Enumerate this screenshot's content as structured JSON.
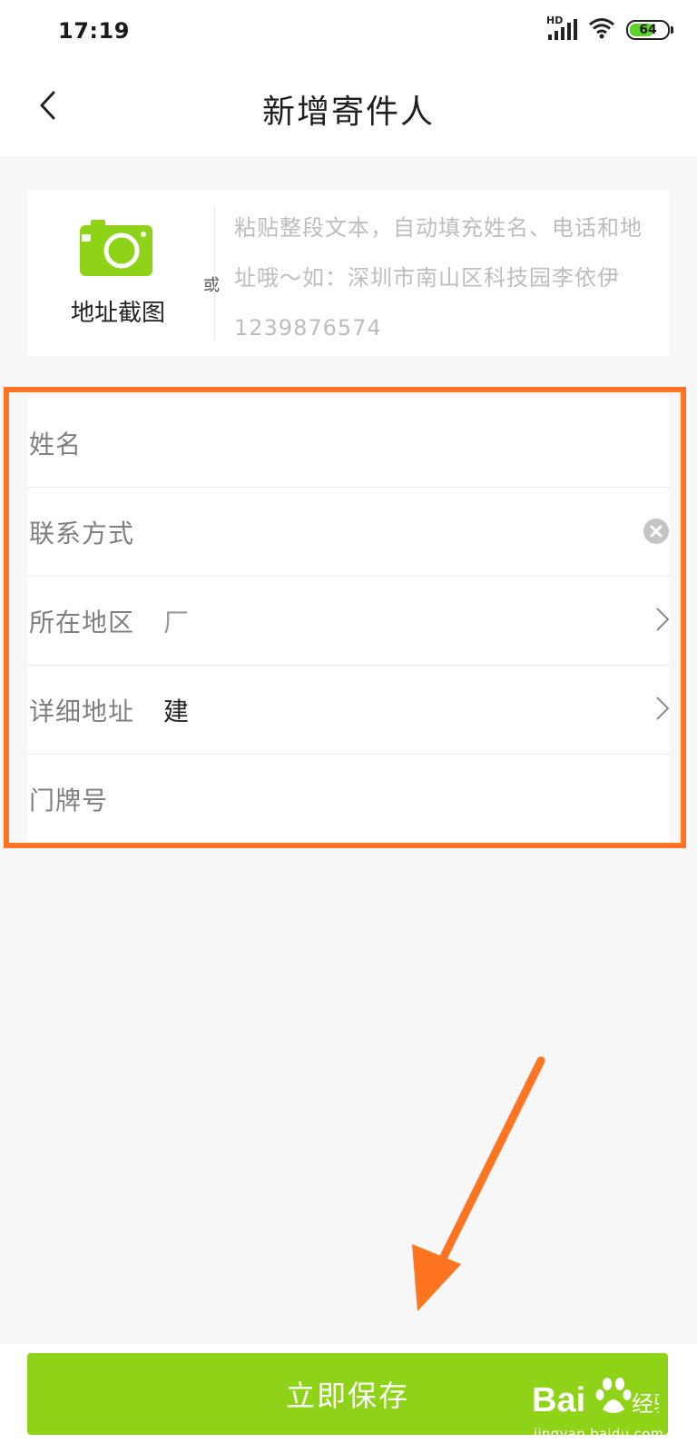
{
  "status_bar": {
    "time": "17:19",
    "network_label": "HD",
    "battery": "64"
  },
  "header": {
    "title": "新增寄件人"
  },
  "paste_card": {
    "screenshot_label": "地址截图",
    "or_label": "或",
    "paste_hint": "粘贴整段文本，自动填充姓名、电话和地址哦～如：深圳市南山区科技园李依伊1239876574"
  },
  "form": {
    "name_label": "姓名",
    "phone_label": "联系方式",
    "region_label": "所在地区",
    "region_value": "厂",
    "address_label": "详细地址",
    "address_value": "建",
    "door_label": "门牌号"
  },
  "footer": {
    "save_label": "立即保存"
  },
  "watermark": {
    "brand": "Bai 经验",
    "url": "jingyan.baidu.com"
  },
  "colors": {
    "accent_green": "#8ed317",
    "highlight_orange": "#ff7420"
  }
}
